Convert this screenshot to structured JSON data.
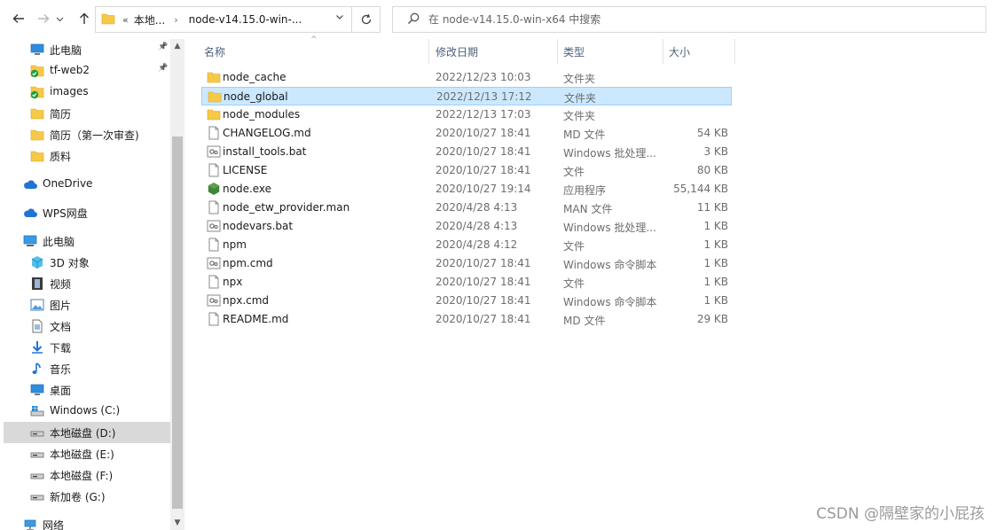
{
  "colors": {
    "folder": "#f7c948",
    "selection_bg": "#cce8ff",
    "selection_border": "#99d1ff",
    "nav_selected": "#d9d9d9",
    "header_text": "#4c607a"
  },
  "toolbar": {
    "back_icon": "arrow-left-icon",
    "forward_icon": "arrow-right-icon",
    "recent_icon": "chevron-down-icon",
    "up_icon": "arrow-up-icon",
    "address": {
      "overflow": "«",
      "crumb_1": "本地...",
      "crumb_2": "node-v14.15.0-win-..."
    },
    "search_placeholder": "在 node-v14.15.0-win-x64 中搜索"
  },
  "nav": {
    "items": [
      {
        "label": "此电脑",
        "icon": "desktop-icon"
      },
      {
        "label": "tf-web2",
        "icon": "folder-icon"
      },
      {
        "label": "images",
        "icon": "folder-icon"
      },
      {
        "label": "简历",
        "icon": "folder-icon"
      },
      {
        "label": "简历（第一次审查)",
        "icon": "folder-icon"
      },
      {
        "label": "质料",
        "icon": "folder-icon"
      },
      {
        "label": "OneDrive",
        "icon": "cloud-icon"
      },
      {
        "label": "WPS网盘",
        "icon": "cloud-icon"
      },
      {
        "label": "此电脑",
        "icon": "computer-icon"
      },
      {
        "label": "3D 对象",
        "icon": "cube-icon"
      },
      {
        "label": "视频",
        "icon": "film-icon"
      },
      {
        "label": "图片",
        "icon": "picture-icon"
      },
      {
        "label": "文档",
        "icon": "document-icon"
      },
      {
        "label": "下载",
        "icon": "download-icon"
      },
      {
        "label": "音乐",
        "icon": "music-icon"
      },
      {
        "label": "桌面",
        "icon": "desktop-icon"
      },
      {
        "label": "Windows (C:)",
        "icon": "drive-icon"
      },
      {
        "label": "本地磁盘 (D:)",
        "icon": "drive-icon"
      },
      {
        "label": "本地磁盘 (E:)",
        "icon": "drive-icon"
      },
      {
        "label": "本地磁盘 (F:)",
        "icon": "drive-icon"
      },
      {
        "label": "新加卷 (G:)",
        "icon": "drive-icon"
      },
      {
        "label": "网络",
        "icon": "network-icon"
      }
    ]
  },
  "columns": {
    "name": "名称",
    "date": "修改日期",
    "type": "类型",
    "size": "大小"
  },
  "files": [
    {
      "name": "node_cache",
      "date": "2022/12/23 10:03",
      "type": "文件夹",
      "size": ""
    },
    {
      "name": "node_global",
      "date": "2022/12/13 17:12",
      "type": "文件夹",
      "size": ""
    },
    {
      "name": "node_modules",
      "date": "2022/12/13 17:03",
      "type": "文件夹",
      "size": ""
    },
    {
      "name": "CHANGELOG.md",
      "date": "2020/10/27 18:41",
      "type": "MD 文件",
      "size": "54 KB"
    },
    {
      "name": "install_tools.bat",
      "date": "2020/10/27 18:41",
      "type": "Windows 批处理...",
      "size": "3 KB"
    },
    {
      "name": "LICENSE",
      "date": "2020/10/27 18:41",
      "type": "文件",
      "size": "80 KB"
    },
    {
      "name": "node.exe",
      "date": "2020/10/27 19:14",
      "type": "应用程序",
      "size": "55,144 KB"
    },
    {
      "name": "node_etw_provider.man",
      "date": "2020/4/28 4:13",
      "type": "MAN 文件",
      "size": "11 KB"
    },
    {
      "name": "nodevars.bat",
      "date": "2020/4/28 4:13",
      "type": "Windows 批处理...",
      "size": "1 KB"
    },
    {
      "name": "npm",
      "date": "2020/4/28 4:12",
      "type": "文件",
      "size": "1 KB"
    },
    {
      "name": "npm.cmd",
      "date": "2020/10/27 18:41",
      "type": "Windows 命令脚本",
      "size": "1 KB"
    },
    {
      "name": "npx",
      "date": "2020/10/27 18:41",
      "type": "文件",
      "size": "1 KB"
    },
    {
      "name": "npx.cmd",
      "date": "2020/10/27 18:41",
      "type": "Windows 命令脚本",
      "size": "1 KB"
    },
    {
      "name": "README.md",
      "date": "2020/10/27 18:41",
      "type": "MD 文件",
      "size": "29 KB"
    }
  ],
  "watermark": "CSDN @隔壁家的小屁孩"
}
